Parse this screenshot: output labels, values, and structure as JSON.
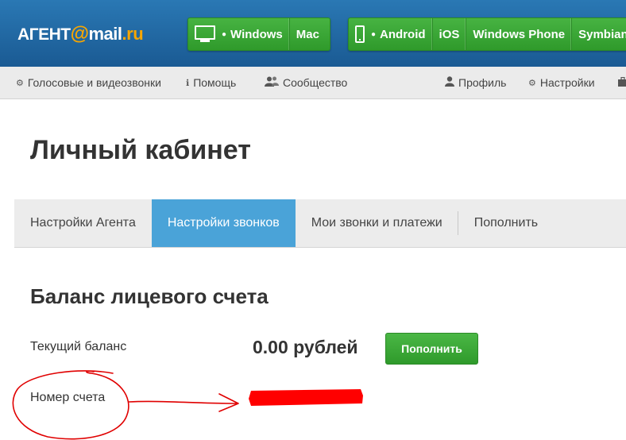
{
  "logo": {
    "agent": "АГЕНТ",
    "at": "@",
    "mail": "mail",
    "ru": ".ru"
  },
  "desktop_platforms": {
    "icon": "monitor-icon",
    "items": [
      "Windows",
      "Mac"
    ]
  },
  "mobile_platforms": {
    "icon": "phone-icon",
    "items": [
      "Android",
      "iOS",
      "Windows Phone",
      "Symbian"
    ]
  },
  "nav": {
    "calls": "Голосовые и видеозвонки",
    "help": "Помощь",
    "community": "Сообщество",
    "profile": "Профиль",
    "settings": "Настройки"
  },
  "page_title": "Личный кабинет",
  "tabs": [
    {
      "label": "Настройки Агента",
      "active": false
    },
    {
      "label": "Настройки звонков",
      "active": true
    },
    {
      "label": "Мои звонки и платежи",
      "active": false
    },
    {
      "label": "Пополнить",
      "active": false
    }
  ],
  "balance": {
    "section_title": "Баланс лицевого счета",
    "current_label": "Текущий баланс",
    "current_value": "0.00 рублей",
    "topup_button": "Пополнить",
    "account_label": "Номер счета"
  },
  "colors": {
    "header_blue": "#1f67a3",
    "green_button": "#3aa635",
    "active_tab": "#4aa3d8",
    "annotation_red": "#e00000"
  }
}
